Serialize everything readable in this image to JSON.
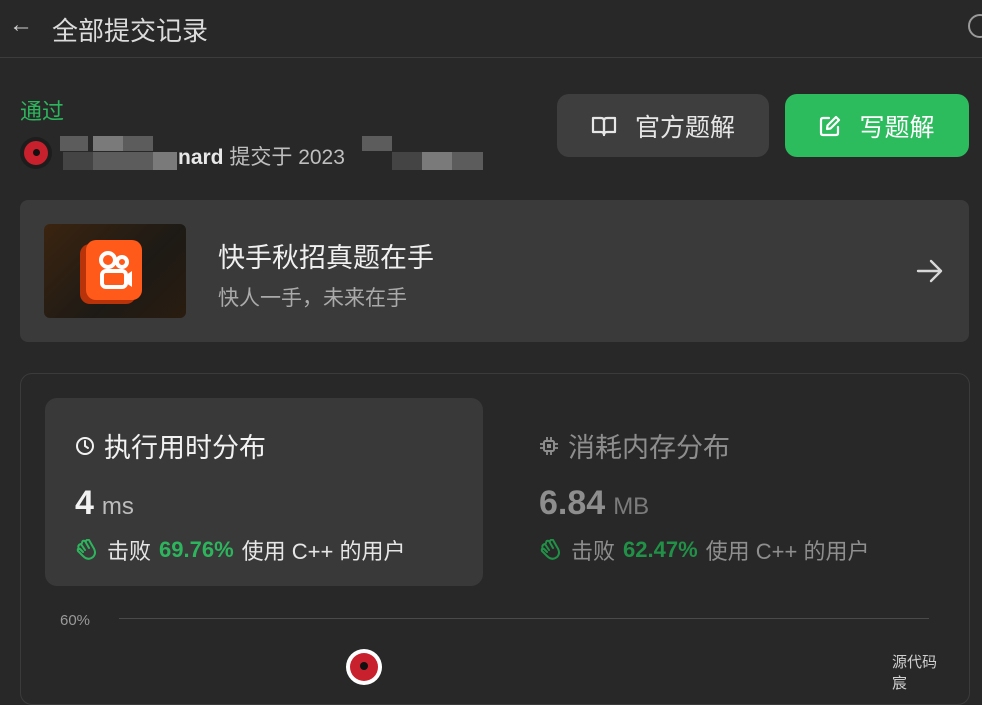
{
  "header": {
    "back_icon": "arrow-left-icon",
    "title": "全部提交记录"
  },
  "submission": {
    "status": "通过",
    "status_color": "#2db55d",
    "submitter_visible": "nard",
    "submitted_text": "提交于 2023"
  },
  "actions": {
    "official_solution_label": "官方题解",
    "write_solution_label": "写题解",
    "accent": "#2cbb5d"
  },
  "promo": {
    "title": "快手秋招真题在手",
    "subtitle": "快人一手，未来在手"
  },
  "runtime": {
    "title": "执行用时分布",
    "value": "4",
    "unit": "ms",
    "beat_label": "击败",
    "percent": "69.76%",
    "lang_text": "使用 C++ 的用户"
  },
  "memory": {
    "title": "消耗内存分布",
    "value": "6.84",
    "unit": "MB",
    "beat_label": "击败",
    "percent": "62.47%",
    "lang_text": "使用 C++ 的用户"
  },
  "chart": {
    "y_tick": "60%"
  },
  "footer": {
    "source_code": "源代码",
    "partial": "宸"
  }
}
